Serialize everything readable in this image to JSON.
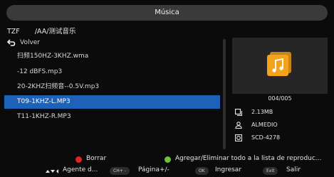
{
  "window": {
    "title": "Música"
  },
  "path": {
    "source": "TZF",
    "folder": "/AA/测试音乐"
  },
  "list": {
    "back_label": "Volver",
    "items": [
      "扫频150HZ-3KHZ.wma",
      "-12 dBFS.mp3",
      "20-2KHZ扫频音--0.5V.mp3",
      "T09-1KHZ-L.MP3",
      "T11-1KHZ-R.MP3"
    ],
    "selected_index": 3
  },
  "info": {
    "counter": "004/005",
    "size": "2.13MB",
    "artist": "ALMEDIO",
    "album": "SCD-4278"
  },
  "legend": {
    "red_label": "Borrar",
    "green_label": "Agregar/Eliminar todo a la lista de reproduc...",
    "nav_label": "Agente d...",
    "page_key": "CH+ -",
    "page_label": "Página+/-",
    "ok_key": "OK",
    "ok_label": "Ingresar",
    "exit_key": "Exit",
    "exit_label": "Salir"
  },
  "colors": {
    "selection": "#1e62b8",
    "accent_orange": "#f2a21b",
    "red": "#e02424",
    "green": "#6cc23a"
  }
}
